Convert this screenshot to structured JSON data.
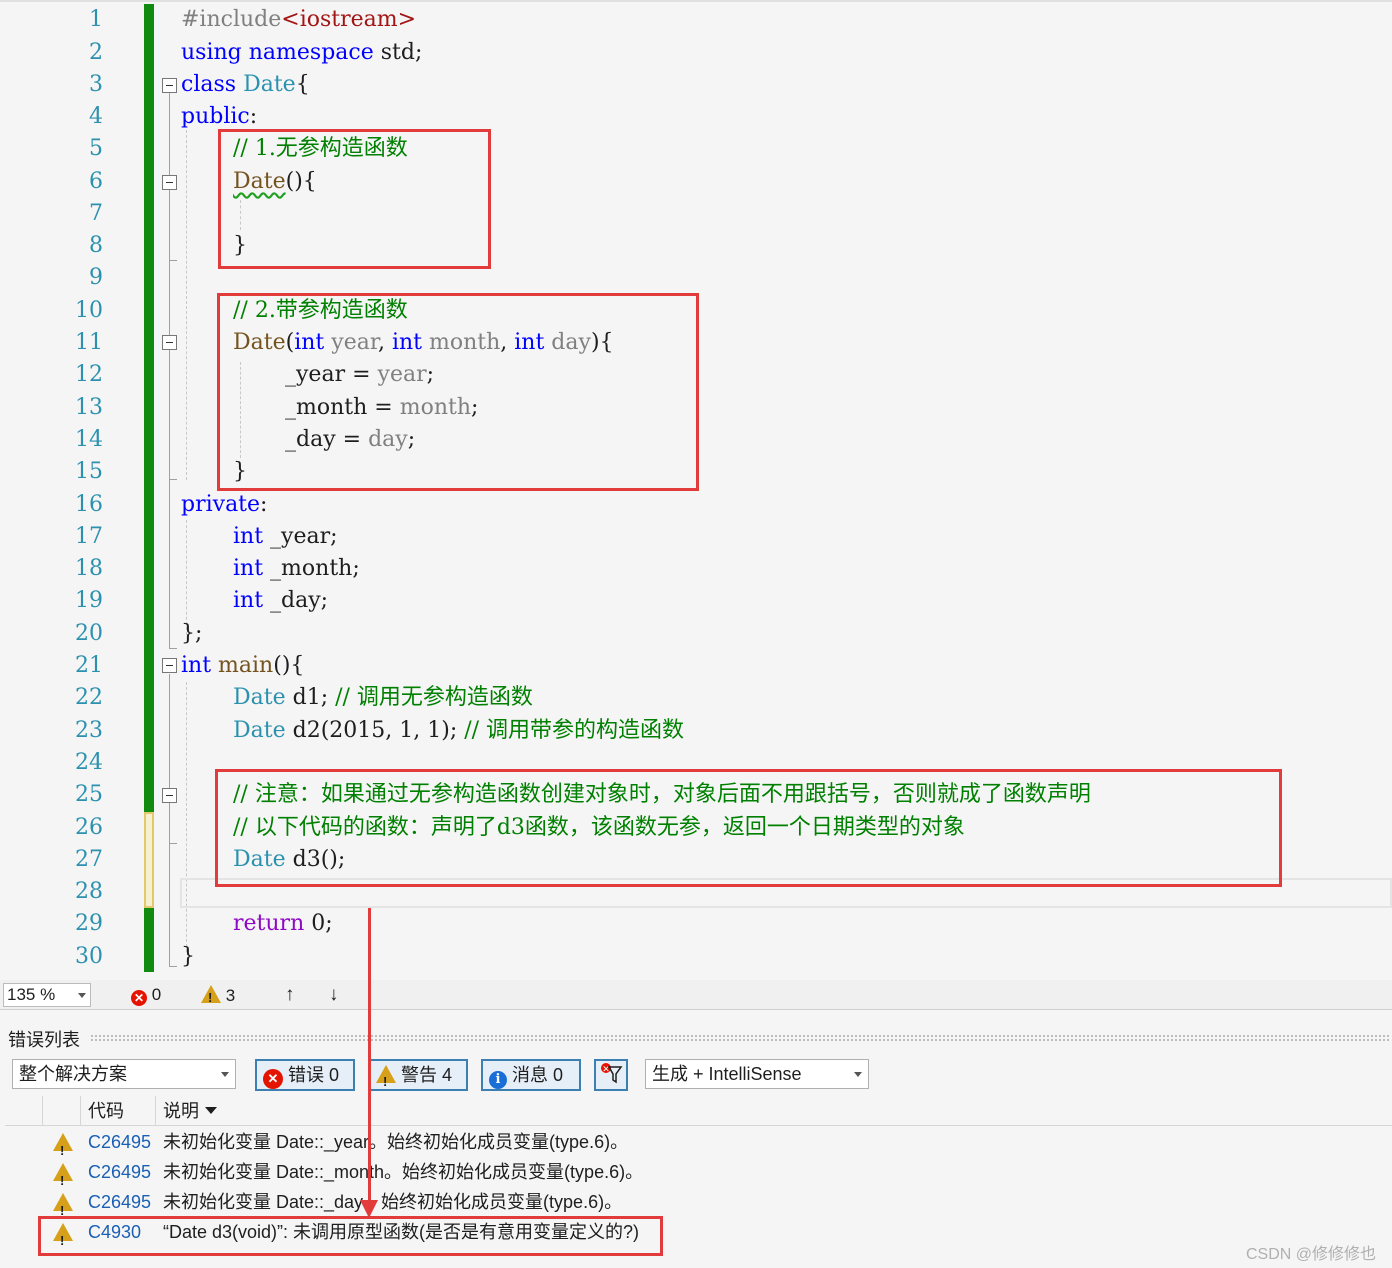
{
  "editor": {
    "line_numbers": [
      "1",
      "2",
      "3",
      "4",
      "5",
      "6",
      "7",
      "8",
      "9",
      "10",
      "11",
      "12",
      "13",
      "14",
      "15",
      "16",
      "17",
      "18",
      "19",
      "20",
      "21",
      "22",
      "23",
      "24",
      "25",
      "26",
      "27",
      "28",
      "29",
      "30"
    ],
    "lines": {
      "l1_pp": "#include",
      "l1_lt": "<",
      "l1_hdr": "iostream",
      "l1_gt": ">",
      "l2_kw1": "using",
      "l2_kw2": "namespace",
      "l2_rest": " std;",
      "l3_kw": "class",
      "l3_type": "Date",
      "l3_brace": "{",
      "l4_kw": "public",
      "l4_colon": ":",
      "l5_comment": "// 1.无参构造函数",
      "l6_fn": "Date",
      "l6_rest": "(){",
      "l8_brace": "}",
      "l10_comment": "// 2.带参构造函数",
      "l11_fn": "Date",
      "l11_p1": "(",
      "l11_int1": "int",
      "l11_year": " year",
      "l11_c1": ", ",
      "l11_int2": "int",
      "l11_month": " month",
      "l11_c2": ", ",
      "l11_int3": "int",
      "l11_day": " day",
      "l11_end": "){",
      "l12_lhs": "_year = ",
      "l12_rhs": "year",
      "l12_semi": ";",
      "l13_lhs": "_month = ",
      "l13_rhs": "month",
      "l13_semi": ";",
      "l14_lhs": "_day = ",
      "l14_rhs": "day",
      "l14_semi": ";",
      "l15_brace": "}",
      "l16_kw": "private",
      "l16_colon": ":",
      "l17_kw": "int",
      "l17_rest": " _year;",
      "l18_kw": "int",
      "l18_rest": " _month;",
      "l19_kw": "int",
      "l19_rest": " _day;",
      "l20_text": "};",
      "l21_kw": "int",
      "l21_fn": " main",
      "l21_rest": "(){",
      "l22_type": "Date",
      "l22_rest": " d1; ",
      "l22_comment": "// 调用无参构造函数",
      "l23_type": "Date",
      "l23_rest": " d2(2015, 1, 1); ",
      "l23_comment": "// 调用带参的构造函数",
      "l25_comment": "// 注意：如果通过无参构造函数创建对象时，对象后面不用跟括号，否则就成了函数声明",
      "l26_comment": "// 以下代码的函数：声明了d3函数，该函数无参，返回一个日期类型的对象",
      "l27_type": "Date",
      "l27_rest": " d3();",
      "l29_kw": "return",
      "l29_rest": " 0;",
      "l30_brace": "}"
    }
  },
  "status_bar": {
    "zoom": "135 %",
    "error_count": "0",
    "warning_count": "3",
    "nav_up": "↑",
    "nav_down": "↓"
  },
  "error_list": {
    "title": "错误列表",
    "scope": "整个解决方案",
    "errors_btn": "错误 0",
    "warnings_btn": "警告 4",
    "messages_btn": "消息 0",
    "source": "生成 + IntelliSense",
    "col_code": "代码",
    "col_desc": "说明",
    "rows": [
      {
        "code": "C26495",
        "desc": "未初始化变量 Date::_year。始终初始化成员变量(type.6)。"
      },
      {
        "code": "C26495",
        "desc": "未初始化变量 Date::_month。始终初始化成员变量(type.6)。"
      },
      {
        "code": "C26495",
        "desc": "未初始化变量 Date::_day。始终初始化成员变量(type.6)。"
      },
      {
        "code": "C4930",
        "desc": "“Date d3(void)”: 未调用原型函数(是否是有意用变量定义的?)"
      }
    ],
    "watermark": "CSDN @修修修也"
  },
  "colors": {
    "keyword": "#0000ff",
    "type": "#2b91af",
    "comment": "#008000",
    "highlight_box": "#e23b3b",
    "change_bar": "#108b10",
    "warning": "#d6a01a",
    "error": "#e51400"
  },
  "icons": {
    "error": "error-x-circle-icon",
    "warning": "warning-triangle-icon",
    "info": "info-circle-icon",
    "filter": "filter-icon",
    "fold": "collapse-minus-icon"
  }
}
